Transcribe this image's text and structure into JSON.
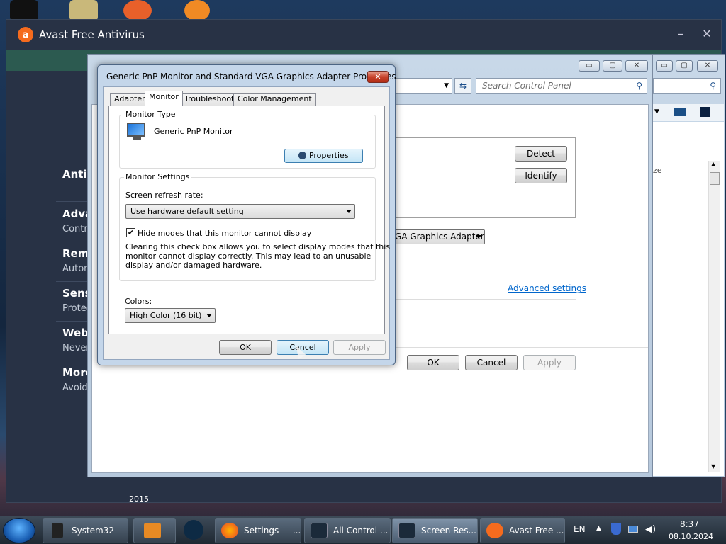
{
  "desktop": {
    "year_label": "2015"
  },
  "avast": {
    "title": "Avast Free Antivirus",
    "minimize": "–",
    "close": "✕",
    "sections": [
      {
        "head": "Antivi",
        "sub": ""
      },
      {
        "head": "Adva",
        "sub": "Contro"
      },
      {
        "head": "Remo",
        "sub": "Autom"
      },
      {
        "head": "Sensi",
        "sub": "Protec"
      },
      {
        "head": "Webc",
        "sub": "Never"
      },
      {
        "head": "More",
        "sub": "Avoid"
      }
    ]
  },
  "control_panel": {
    "search_placeholder": "Search Control Panel",
    "detect": "Detect",
    "identify": "Identify",
    "display_select": "GA Graphics Adapter",
    "advanced_settings": "Advanced settings",
    "ok": "OK",
    "cancel": "Cancel",
    "apply": "Apply",
    "side_text": "ze"
  },
  "dialog": {
    "title": "Generic PnP Monitor and Standard VGA Graphics Adapter Properties",
    "close": "✕",
    "tabs": [
      "Adapter",
      "Monitor",
      "Troubleshoot",
      "Color Management"
    ],
    "active_tab": "Monitor",
    "monitor_type_label": "Monitor Type",
    "monitor_name": "Generic PnP Monitor",
    "properties": "Properties",
    "monitor_settings_label": "Monitor Settings",
    "refresh_label": "Screen refresh rate:",
    "refresh_value": "Use hardware default setting",
    "hide_modes_label": "Hide modes that this monitor cannot display",
    "hide_modes_checked": true,
    "warning": [
      "Clearing this check box allows you to select display modes that this",
      "monitor cannot display correctly. This may lead to an unusable",
      "display and/or damaged hardware."
    ],
    "colors_label": "Colors:",
    "colors_value": "High Color (16 bit)",
    "ok": "OK",
    "cancel": "Cancel",
    "apply": "Apply"
  },
  "taskbar": {
    "items": [
      {
        "label": "System32"
      },
      {
        "label": ""
      },
      {
        "label": ""
      },
      {
        "label": "Settings — ..."
      },
      {
        "label": "All Control ..."
      },
      {
        "label": "Screen Res..."
      },
      {
        "label": "Avast Free ..."
      }
    ],
    "lang": "EN",
    "time": "8:37",
    "date": "08.10.2024"
  },
  "colors": {
    "accent": "#f56b1e",
    "link": "#0066cc",
    "avast_bg": "#283245",
    "taskbar": "#2a3542"
  }
}
